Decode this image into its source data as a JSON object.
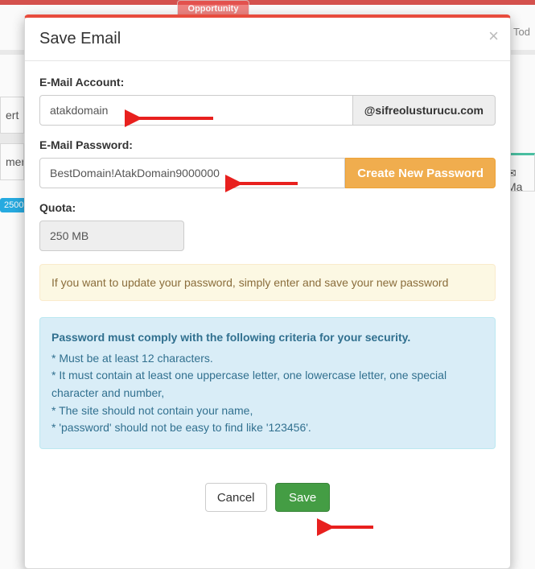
{
  "background": {
    "opportunity_badge": "Opportunity",
    "today": "Tod",
    "sidebar_ert": "ert",
    "sidebar_men": "men",
    "sidebar_badge": "2500",
    "email_col": "✉Ma"
  },
  "modal": {
    "title": "Save Email",
    "close": "×",
    "email_account_label": "E-Mail Account:",
    "email_account_value": "atakdomain",
    "email_domain": "@sifreolusturucu.com",
    "password_label": "E-Mail Password:",
    "password_value": "BestDomain!AtakDomain9000000",
    "create_password_btn": "Create New Password",
    "quota_label": "Quota:",
    "quota_value": "250 MB",
    "info_warning": "If you want to update your password, simply enter and save your new password",
    "criteria_title": "Password must comply with the following criteria for your security.",
    "criteria_1": "* Must be at least 12 characters.",
    "criteria_2": "* It must contain at least one uppercase letter, one lowercase letter, one special character and number,",
    "criteria_3": "* The site should not contain your name,",
    "criteria_4": "* 'password' should not be easy to find like '123456'.",
    "cancel": "Cancel",
    "save": "Save"
  },
  "annotations": {
    "arrow_color": "#e8201e"
  }
}
